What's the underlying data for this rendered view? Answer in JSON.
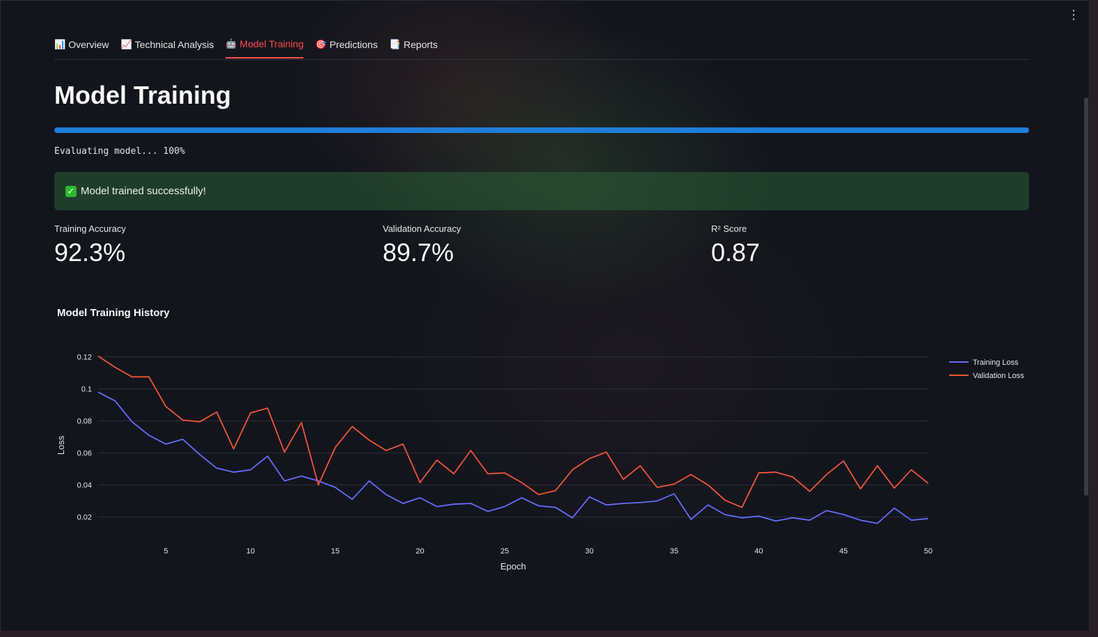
{
  "tabs": [
    {
      "icon": "📊",
      "icon_name": "bar-chart-icon",
      "label": "Overview"
    },
    {
      "icon": "📈",
      "icon_name": "trend-chart-icon",
      "label": "Technical Analysis"
    },
    {
      "icon": "🤖",
      "icon_name": "robot-icon",
      "label": "Model Training",
      "active": true
    },
    {
      "icon": "🎯",
      "icon_name": "target-icon",
      "label": "Predictions"
    },
    {
      "icon": "📑",
      "icon_name": "report-icon",
      "label": "Reports"
    }
  ],
  "page": {
    "title": "Model Training"
  },
  "progress": {
    "value_percent": 100,
    "text": "Evaluating model... 100%",
    "color": "#1f7ed8"
  },
  "alert": {
    "icon": "✅",
    "text": "Model trained successfully!"
  },
  "metrics": [
    {
      "label": "Training Accuracy",
      "value": "92.3%"
    },
    {
      "label": "Validation Accuracy",
      "value": "89.7%"
    },
    {
      "label": "R² Score",
      "value": "0.87"
    }
  ],
  "colors": {
    "accent": "#ff4b4b",
    "training_line": "#636efa",
    "validation_line": "#ef553b"
  },
  "chart_data": {
    "type": "line",
    "title": "Model Training History",
    "xlabel": "Epoch",
    "ylabel": "Loss",
    "xlim": [
      1,
      50
    ],
    "ylim": [
      0.012,
      0.122
    ],
    "x_ticks": [
      5,
      10,
      15,
      20,
      25,
      30,
      35,
      40,
      45,
      50
    ],
    "y_ticks": [
      0.02,
      0.04,
      0.06,
      0.08,
      0.1,
      0.12
    ],
    "y_tick_labels": [
      "0.02",
      "0.04",
      "0.06",
      "0.08",
      "0.1",
      "0.12"
    ],
    "grid": true,
    "legend_position": "top-right",
    "x": [
      1,
      2,
      3,
      4,
      5,
      6,
      7,
      8,
      9,
      10,
      11,
      12,
      13,
      14,
      15,
      16,
      17,
      18,
      19,
      20,
      21,
      22,
      23,
      24,
      25,
      26,
      27,
      28,
      29,
      30,
      31,
      32,
      33,
      34,
      35,
      36,
      37,
      38,
      39,
      40,
      41,
      42,
      43,
      44,
      45,
      46,
      47,
      48,
      49,
      50
    ],
    "series": [
      {
        "name": "Training Loss",
        "values": [
          0.098,
          0.0925,
          0.0795,
          0.071,
          0.0655,
          0.0685,
          0.059,
          0.0505,
          0.048,
          0.0495,
          0.058,
          0.0425,
          0.0455,
          0.0425,
          0.0385,
          0.031,
          0.0425,
          0.034,
          0.0285,
          0.032,
          0.0265,
          0.028,
          0.0285,
          0.0235,
          0.0265,
          0.032,
          0.027,
          0.026,
          0.0195,
          0.0325,
          0.0275,
          0.0285,
          0.029,
          0.03,
          0.0345,
          0.0185,
          0.0275,
          0.0215,
          0.0195,
          0.0205,
          0.0175,
          0.0195,
          0.018,
          0.024,
          0.0215,
          0.018,
          0.016,
          0.0255,
          0.018,
          0.019
        ]
      },
      {
        "name": "Validation Loss",
        "values": [
          0.1205,
          0.1135,
          0.1075,
          0.1075,
          0.089,
          0.0805,
          0.0795,
          0.0855,
          0.0625,
          0.085,
          0.088,
          0.0605,
          0.079,
          0.04,
          0.0635,
          0.0765,
          0.068,
          0.0615,
          0.0655,
          0.0415,
          0.0555,
          0.047,
          0.0615,
          0.047,
          0.0475,
          0.0415,
          0.034,
          0.0365,
          0.0495,
          0.0565,
          0.0605,
          0.0435,
          0.052,
          0.0385,
          0.0405,
          0.0465,
          0.04,
          0.0305,
          0.026,
          0.0475,
          0.048,
          0.045,
          0.036,
          0.0465,
          0.055,
          0.0375,
          0.052,
          0.038,
          0.0495,
          0.041
        ]
      }
    ]
  }
}
